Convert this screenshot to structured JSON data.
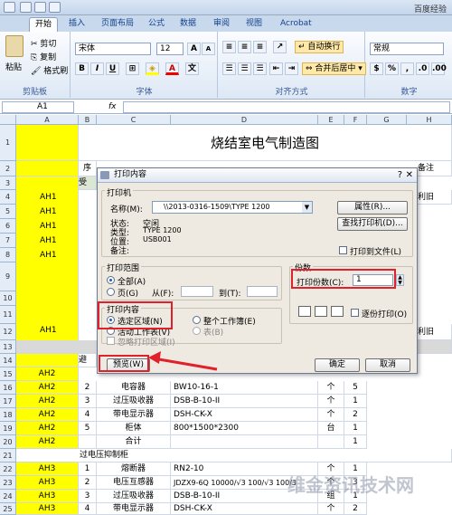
{
  "app": {
    "title": "百度经验"
  },
  "tabs": [
    "开始",
    "插入",
    "页面布局",
    "公式",
    "数据",
    "审阅",
    "视图",
    "Acrobat"
  ],
  "ribbon": {
    "paste": "粘贴",
    "cut": "剪切",
    "copy": "复制",
    "format_painter": "格式刷",
    "clipboard_label": "剪贴板",
    "font_name": "宋体",
    "font_size": "12",
    "font_label": "字体",
    "wrap_text": "自动换行",
    "merge_center": "合并后居中",
    "align_label": "对齐方式",
    "number_format": "常规",
    "number_label": "数字"
  },
  "formula_bar": {
    "cell_ref": "A1",
    "fx": "fx"
  },
  "columns": [
    "A",
    "B",
    "C",
    "D",
    "E",
    "F",
    "G",
    "H"
  ],
  "rows": [
    "1",
    "2",
    "3",
    "4",
    "5",
    "6",
    "7",
    "8",
    "9",
    "10",
    "11",
    "12",
    "13",
    "14",
    "15",
    "16",
    "17",
    "18",
    "19",
    "20",
    "21",
    "22",
    "23",
    "24",
    "25"
  ],
  "sheet": {
    "title": "烧结室电气制造图",
    "header_seq": "序",
    "header_note": "备注",
    "row3_b": "受",
    "right_1": "利旧",
    "right_2": "利旧",
    "row14_b": "避",
    "ah1": [
      "AH1",
      "AH1",
      "AH1",
      "AH1",
      "AH1",
      "AH1"
    ],
    "ah2": [
      "AH2",
      "AH2",
      "AH2",
      "AH2",
      "AH2",
      "AH2"
    ],
    "ah3": [
      "AH3",
      "AH3",
      "AH3",
      "AH3"
    ],
    "lower_rows": [
      {
        "no": "2",
        "name": "电容器",
        "model": "BW10-16-1",
        "unit": "个",
        "qty": "5"
      },
      {
        "no": "3",
        "name": "过压吸收器",
        "model": "DSB-B-10-II",
        "unit": "个",
        "qty": "1"
      },
      {
        "no": "4",
        "name": "带电显示器",
        "model": "DSH-CK-X",
        "unit": "个",
        "qty": "2"
      },
      {
        "no": "5",
        "name": "柜体",
        "model": "800*1500*2300",
        "unit": "台",
        "qty": "1"
      },
      {
        "no": "",
        "name": "合计",
        "model": "",
        "unit": "",
        "qty": "1"
      }
    ],
    "section_title": "过电压抑制柜",
    "bottom_rows": [
      {
        "no": "1",
        "name": "熔断器",
        "model": "RN2-10",
        "unit": "个",
        "qty": "1"
      },
      {
        "no": "2",
        "name": "电压互感器",
        "model": "JDZX9-6Q 10000/√3 100/√3 100/3",
        "unit": "个",
        "qty": "3"
      },
      {
        "no": "3",
        "name": "过压吸收器",
        "model": "DSB-B-10-II",
        "unit": "组",
        "qty": "1"
      },
      {
        "no": "4",
        "name": "带电显示器",
        "model": "DSH-CK-X",
        "unit": "个",
        "qty": "2"
      }
    ]
  },
  "dialog": {
    "title": "打印内容",
    "printer_group": "打印机",
    "name_label": "名称(M):",
    "printer_name": "\\\\2013-0316-1509\\TYPE 1200",
    "status_label": "状态:",
    "status_value": "空闲",
    "type_label": "类型:",
    "type_value": "TYPE 1200",
    "where_label": "位置:",
    "where_value": "USB001",
    "comment_label": "备注:",
    "properties_btn": "属性(R)...",
    "find_printer_btn": "查找打印机(D)...",
    "print_to_file": "打印到文件(L)",
    "range_group": "打印范围",
    "range_all": "全部(A)",
    "range_pages": "页(G)",
    "from_label": "从(F):",
    "to_label": "到(T):",
    "copies_group": "份数",
    "copies_label": "打印份数(C):",
    "copies_value": "1",
    "collate": "逐份打印(O)",
    "what_group": "打印内容",
    "what_selection": "选定区域(N)",
    "what_workbook": "整个工作簿(E)",
    "what_active": "活动工作表(V)",
    "what_table": "表(B)",
    "ignore_area": "忽略打印区域(I)",
    "preview_btn": "预览(W)",
    "ok_btn": "确定",
    "cancel_btn": "取消"
  },
  "watermark": "维金资讯技术网"
}
